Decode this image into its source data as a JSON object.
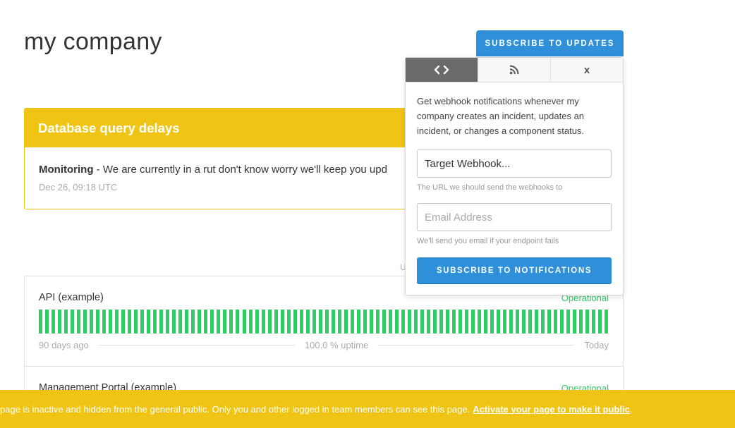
{
  "page": {
    "title": "my company",
    "subscribe_button": "SUBSCRIBE TO UPDATES"
  },
  "incident": {
    "title": "Database query delays",
    "update_status": "Monitoring",
    "update_text": " - We are currently in a rut don't know worry we'll keep you upd",
    "date": "Dec 26, 09:18 UTC"
  },
  "uptime_hint": "U",
  "components": [
    {
      "name": "API (example)",
      "status": "Operational",
      "uptime_bar_count": 90,
      "legend_start": "90 days ago",
      "legend_uptime": "100.0 % uptime",
      "legend_end": "Today"
    },
    {
      "name": "Management Portal (example)",
      "status": "Operational"
    }
  ],
  "popover": {
    "tabs": [
      {
        "icon": "webhook-code-icon",
        "active": true
      },
      {
        "icon": "rss-icon",
        "active": false
      },
      {
        "label": "x",
        "icon": "close-icon",
        "active": false
      }
    ],
    "description": "Get webhook notifications whenever my company creates an incident, updates an incident, or changes a component status.",
    "webhook_value": "Target Webhook...",
    "webhook_help": "The URL we should send the webhooks to",
    "email_placeholder": "Email Address",
    "email_help": "We'll send you email if your endpoint fails",
    "submit_label": "SUBSCRIBE TO NOTIFICATIONS"
  },
  "banner": {
    "text": "page is inactive and hidden from the general public. Only you and other logged in team members can see this page.",
    "link": "Activate your page to make it public",
    "trailing": "."
  },
  "colors": {
    "accent_blue": "#2f8fd8",
    "incident_yellow": "#f0c414",
    "operational_green": "#2fcc66"
  }
}
